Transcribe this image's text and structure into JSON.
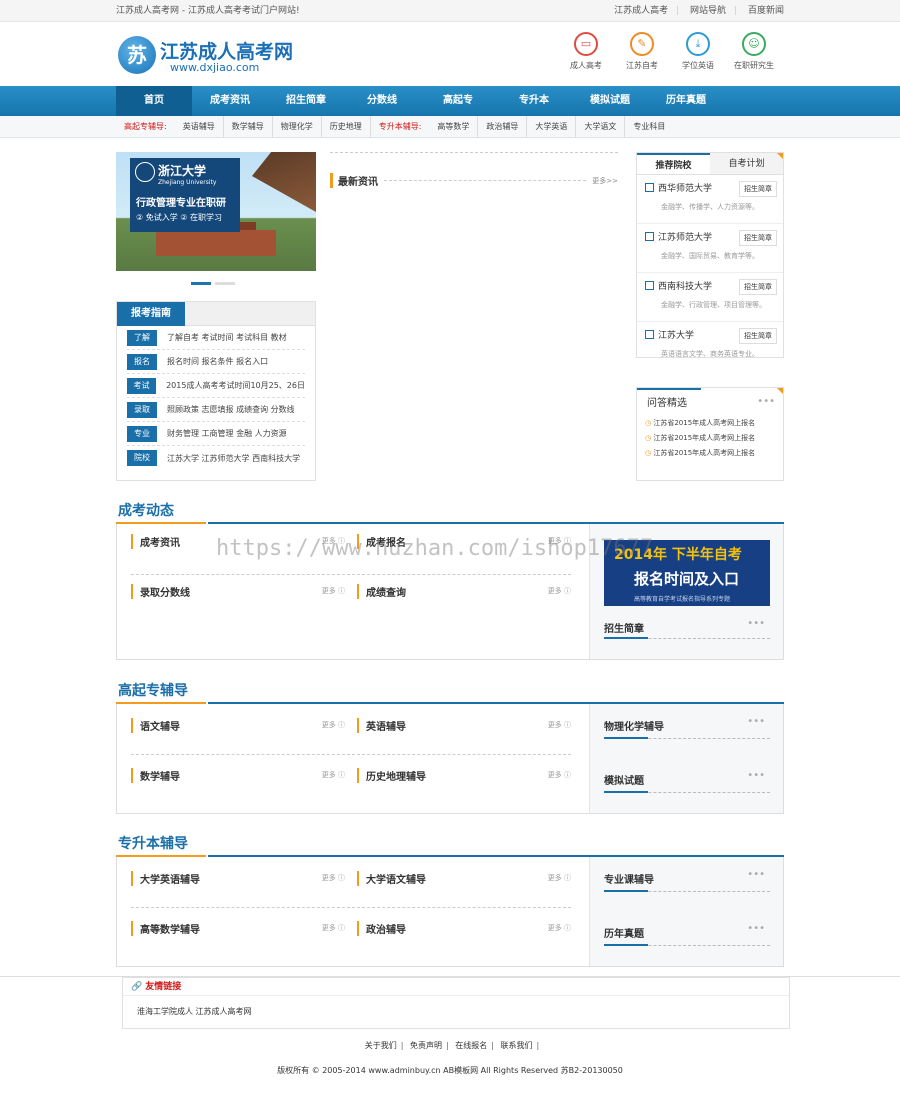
{
  "topbar": {
    "left": "江苏成人高考网 - 江苏成人高考考试门户网站!",
    "links": [
      "江苏成人高考",
      "网站导航",
      "百度新闻"
    ]
  },
  "logo": {
    "mark": "苏",
    "name": "江苏成人高考网",
    "url": "www.dxjiao.com"
  },
  "header_icons": [
    {
      "label": "成人高考",
      "icon": "video-icon",
      "color": "#e34a3f"
    },
    {
      "label": "江苏自考",
      "icon": "edit-icon",
      "color": "#f08a24"
    },
    {
      "label": "学位英语",
      "icon": "download-icon",
      "color": "#2a9bd7"
    },
    {
      "label": "在职研究生",
      "icon": "users-icon",
      "color": "#3aaa5c"
    }
  ],
  "nav": [
    "首页",
    "成考资讯",
    "招生简章",
    "分数线",
    "高起专",
    "专升本",
    "模拟试题",
    "历年真题"
  ],
  "subnav": {
    "label1": "高起专辅导:",
    "items1": [
      "英语辅导",
      "数学辅导",
      "物理化学",
      "历史地理"
    ],
    "label2": "专升本辅导:",
    "items2": [
      "高等数学",
      "政治辅导",
      "大学英语",
      "大学语文",
      "专业科目"
    ]
  },
  "banner": {
    "univ": "浙江大学",
    "univ_en": "Zhejiang University",
    "line1": "行政管理专业在职研",
    "line2": "② 免试入学  ② 在职学习"
  },
  "guide": {
    "title": "报考指南",
    "rows": [
      {
        "tag": "了解",
        "text": "了解自考  考试时间  考试科目  教材"
      },
      {
        "tag": "报名",
        "text": "报名时间  报名条件  报名入口"
      },
      {
        "tag": "考试",
        "text": "2015成人高考考试时间10月25、26日"
      },
      {
        "tag": "录取",
        "text": "照顾政策  志愿填报  成绩查询  分数线"
      },
      {
        "tag": "专业",
        "text": "财务管理  工商管理  金融  人力资源"
      },
      {
        "tag": "院校",
        "text": "江苏大学  江苏师范大学  西南科技大学"
      }
    ]
  },
  "news": {
    "title": "最新资讯",
    "more": "更多>>"
  },
  "rec": {
    "tabs": [
      "推荐院校",
      "自考计划"
    ],
    "button": "招生简章",
    "items": [
      {
        "name": "西华师范大学",
        "desc": "金融学、传播学、人力资源等。"
      },
      {
        "name": "江苏师范大学",
        "desc": "金融学、国际贸易、教育学等。"
      },
      {
        "name": "西南科技大学",
        "desc": "金融学、行政管理、项目管理等。"
      },
      {
        "name": "江苏大学",
        "desc": "英语语言文学、商务英语专业。"
      }
    ]
  },
  "qa": {
    "title": "问答精选",
    "more": "•••",
    "items": [
      "江苏省2015年成人高考网上报名",
      "江苏省2015年成人高考网上报名",
      "江苏省2015年成人高考网上报名"
    ]
  },
  "sections": [
    {
      "title": "成考动态",
      "cells": [
        "成考资讯",
        "成考报名",
        "录取分数线",
        "成绩查询"
      ],
      "side": [
        "招生简章"
      ],
      "promo": {
        "a": "2014年 下半年自考",
        "b": "报名时间及入口",
        "c": "高等教育自学考试报名指导系列专题"
      }
    },
    {
      "title": "高起专辅导",
      "cells": [
        "语文辅导",
        "英语辅导",
        "数学辅导",
        "历史地理辅导"
      ],
      "side": [
        "物理化学辅导",
        "模拟试题"
      ]
    },
    {
      "title": "专升本辅导",
      "cells": [
        "大学英语辅导",
        "大学语文辅导",
        "高等数学辅导",
        "政治辅导"
      ],
      "side": [
        "专业课辅导",
        "历年真题"
      ]
    }
  ],
  "more": "更多",
  "side_more": "•••",
  "links": {
    "title": "友情链接",
    "text": "淮海工学院成人  江苏成人高考网"
  },
  "footer": {
    "links": [
      "关于我们",
      "免责声明",
      "在线报名",
      "联系我们"
    ],
    "copyright": "版权所有 © 2005-2014  www.adminbuy.cn AB模板网  All Rights Reserved 苏B2-20130050"
  },
  "watermark": "https://www.huzhan.com/ishop17677"
}
